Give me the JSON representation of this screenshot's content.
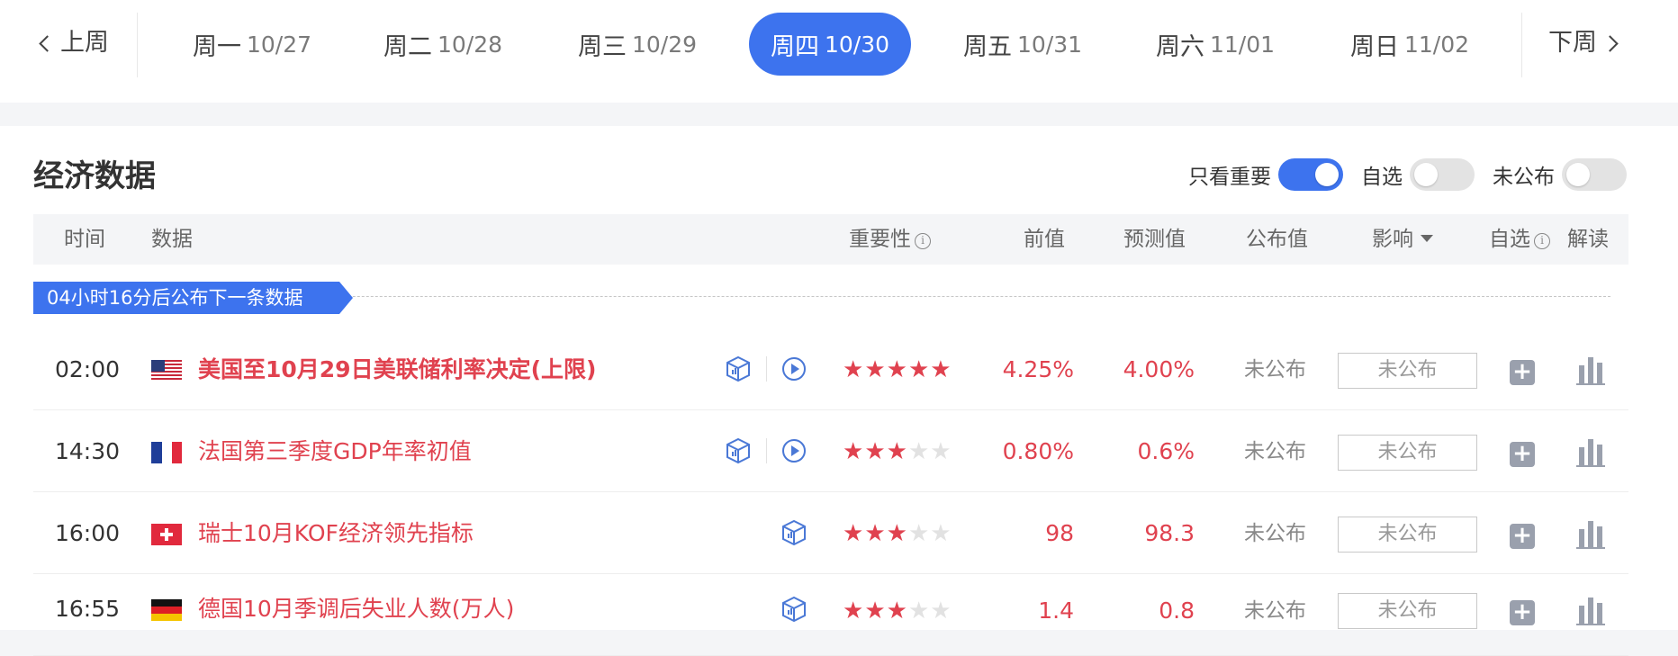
{
  "week_nav": {
    "prev_label": "上周",
    "next_label": "下周",
    "days": [
      {
        "name": "周一",
        "date": "10/27"
      },
      {
        "name": "周二",
        "date": "10/28"
      },
      {
        "name": "周三",
        "date": "10/29"
      },
      {
        "name": "周四",
        "date": "10/30"
      },
      {
        "name": "周五",
        "date": "10/31"
      },
      {
        "name": "周六",
        "date": "11/01"
      },
      {
        "name": "周日",
        "date": "11/02"
      }
    ],
    "active_index": 3
  },
  "panel": {
    "title": "经济数据",
    "filters": {
      "important_label": "只看重要",
      "watchlist_label": "自选",
      "unpublished_label": "未公布"
    }
  },
  "table": {
    "headers": {
      "time": "时间",
      "data": "数据",
      "importance": "重要性",
      "previous": "前值",
      "forecast": "预测值",
      "actual": "公布值",
      "impact": "影响",
      "watch": "自选",
      "analysis": "解读"
    },
    "countdown": "04小时16分后公布下一条数据",
    "rows": [
      {
        "time": "02:00",
        "flag": "us",
        "name": "美国至10月29日美联储利率决定(上限)",
        "stars": 5,
        "previous": "4.25%",
        "forecast": "4.00%",
        "actual": "未公布",
        "impact": "未公布"
      },
      {
        "time": "14:30",
        "flag": "fr",
        "name": "法国第三季度GDP年率初值",
        "stars": 3,
        "previous": "0.80%",
        "forecast": "0.6%",
        "actual": "未公布",
        "impact": "未公布"
      },
      {
        "time": "16:00",
        "flag": "ch",
        "name": "瑞士10月KOF经济领先指标",
        "stars": 3,
        "previous": "98",
        "forecast": "98.3",
        "actual": "未公布",
        "impact": "未公布"
      },
      {
        "time": "16:55",
        "flag": "de",
        "name": "德国10月季调后失业人数(万人)",
        "stars": 3,
        "previous": "1.4",
        "forecast": "0.8",
        "actual": "未公布",
        "impact": "未公布"
      }
    ]
  },
  "colors": {
    "accent": "#3d73ee",
    "highlight": "#e0424f"
  }
}
